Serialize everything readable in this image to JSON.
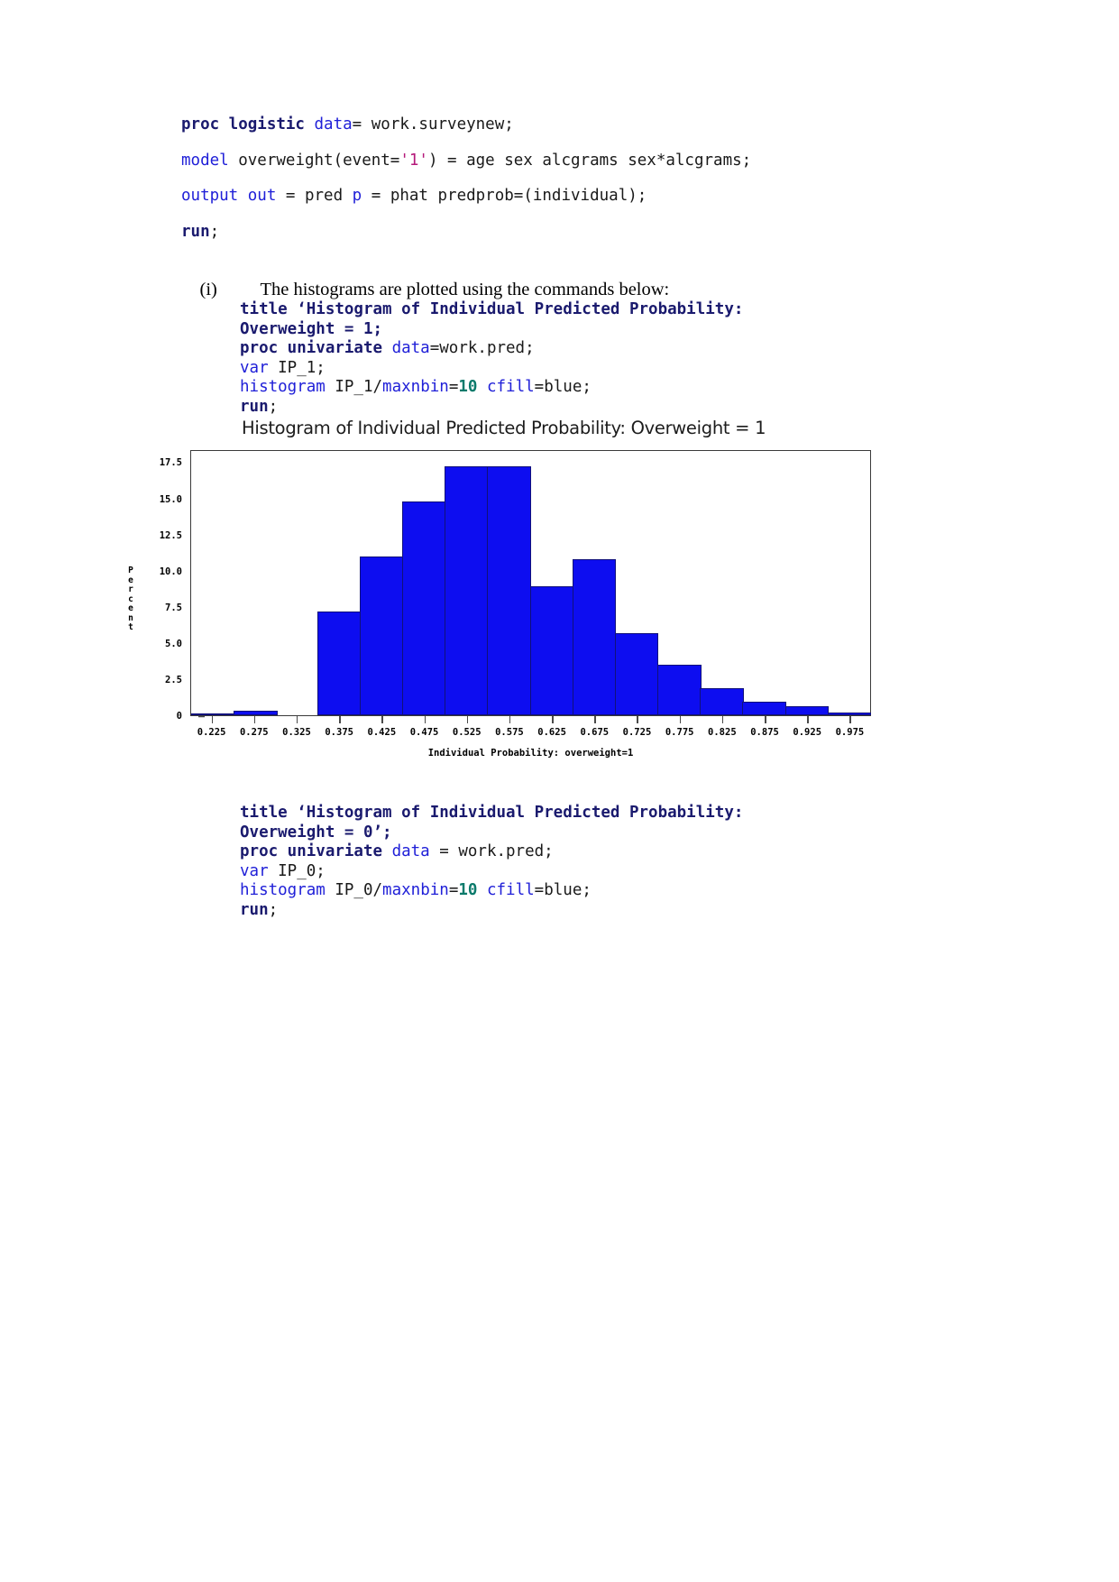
{
  "code_top": {
    "lines": [
      [
        {
          "t": "proc logistic ",
          "c": "kw"
        },
        {
          "t": "data",
          "c": "opt"
        },
        {
          "t": "= work.surveynew;",
          "c": "plain"
        }
      ],
      [
        {
          "t": "model",
          "c": "opt"
        },
        {
          "t": " overweight(event=",
          "c": "plain"
        },
        {
          "t": "'1'",
          "c": "str"
        },
        {
          "t": ") = age sex alcgrams sex*alcgrams;",
          "c": "plain"
        }
      ],
      [
        {
          "t": "output",
          "c": "opt"
        },
        {
          "t": " ",
          "c": "plain"
        },
        {
          "t": "out",
          "c": "opt"
        },
        {
          "t": " = pred ",
          "c": "plain"
        },
        {
          "t": "p",
          "c": "opt"
        },
        {
          "t": " = phat predprob=(individual);",
          "c": "plain"
        }
      ],
      [
        {
          "t": "run",
          "c": "kw"
        },
        {
          "t": ";",
          "c": "plain"
        }
      ]
    ]
  },
  "paragraph": {
    "marker": "(i)",
    "text": "The histograms are plotted using the commands below:"
  },
  "code_block_1": {
    "lines": [
      [
        {
          "t": "title ‘Histogram of Individual Predicted Probability:",
          "c": "kw"
        }
      ],
      [
        {
          "t": "Overweight = 1;",
          "c": "kw"
        }
      ],
      [
        {
          "t": "proc univariate ",
          "c": "kw"
        },
        {
          "t": "data",
          "c": "opt"
        },
        {
          "t": "=work.pred;",
          "c": "plain"
        }
      ],
      [
        {
          "t": "var",
          "c": "opt"
        },
        {
          "t": " IP_1;",
          "c": "plain"
        }
      ],
      [
        {
          "t": "histogram",
          "c": "opt"
        },
        {
          "t": " IP_1/",
          "c": "plain"
        },
        {
          "t": "maxnbin",
          "c": "opt"
        },
        {
          "t": "=",
          "c": "plain"
        },
        {
          "t": "10",
          "c": "num"
        },
        {
          "t": " ",
          "c": "plain"
        },
        {
          "t": "cfill",
          "c": "opt"
        },
        {
          "t": "=blue;",
          "c": "plain"
        }
      ],
      [
        {
          "t": "run",
          "c": "kw"
        },
        {
          "t": ";",
          "c": "plain"
        }
      ]
    ]
  },
  "code_block_2": {
    "lines": [
      [
        {
          "t": "title ‘Histogram of Individual Predicted Probability:",
          "c": "kw"
        }
      ],
      [
        {
          "t": "Overweight = 0’;",
          "c": "kw"
        }
      ],
      [
        {
          "t": "proc univariate ",
          "c": "kw"
        },
        {
          "t": "data",
          "c": "opt"
        },
        {
          "t": " = work.pred;",
          "c": "plain"
        }
      ],
      [
        {
          "t": "var",
          "c": "opt"
        },
        {
          "t": " IP_0;",
          "c": "plain"
        }
      ],
      [
        {
          "t": "histogram",
          "c": "opt"
        },
        {
          "t": " IP_0/",
          "c": "plain"
        },
        {
          "t": "maxnbin",
          "c": "opt"
        },
        {
          "t": "=",
          "c": "plain"
        },
        {
          "t": "10",
          "c": "num"
        },
        {
          "t": " ",
          "c": "plain"
        },
        {
          "t": "cfill",
          "c": "opt"
        },
        {
          "t": "=blue;",
          "c": "plain"
        }
      ],
      [
        {
          "t": "run",
          "c": "kw"
        },
        {
          "t": ";",
          "c": "plain"
        }
      ]
    ]
  },
  "chart_data": {
    "type": "bar",
    "title": "Histogram of Individual Predicted Probability: Overweight = 1",
    "xlabel": "Individual Probability: overweight=1",
    "ylabel": "Percent",
    "ylabel_chars": [
      "P",
      "e",
      "r",
      "c",
      "e",
      "n",
      "t"
    ],
    "categories": [
      "0.225",
      "0.275",
      "0.325",
      "0.375",
      "0.425",
      "0.475",
      "0.525",
      "0.575",
      "0.625",
      "0.675",
      "0.725",
      "0.775",
      "0.825",
      "0.875",
      "0.925",
      "0.975"
    ],
    "values": [
      0.15,
      0.3,
      0.0,
      7.2,
      11.0,
      14.8,
      17.2,
      17.2,
      8.9,
      10.8,
      5.7,
      3.5,
      1.9,
      0.95,
      0.6,
      0.2
    ],
    "yticks": [
      0,
      2.5,
      5.0,
      7.5,
      10.0,
      12.5,
      15.0,
      17.5
    ],
    "ytick_labels": [
      "0",
      "2.5",
      "5.0",
      "7.5",
      "10.0",
      "12.5",
      "15.0",
      "17.5"
    ],
    "ylim": [
      0,
      18.4
    ],
    "grid": false,
    "legend": "none",
    "bar_color": "#0d0df0",
    "bar_border_color": "#11117a"
  }
}
